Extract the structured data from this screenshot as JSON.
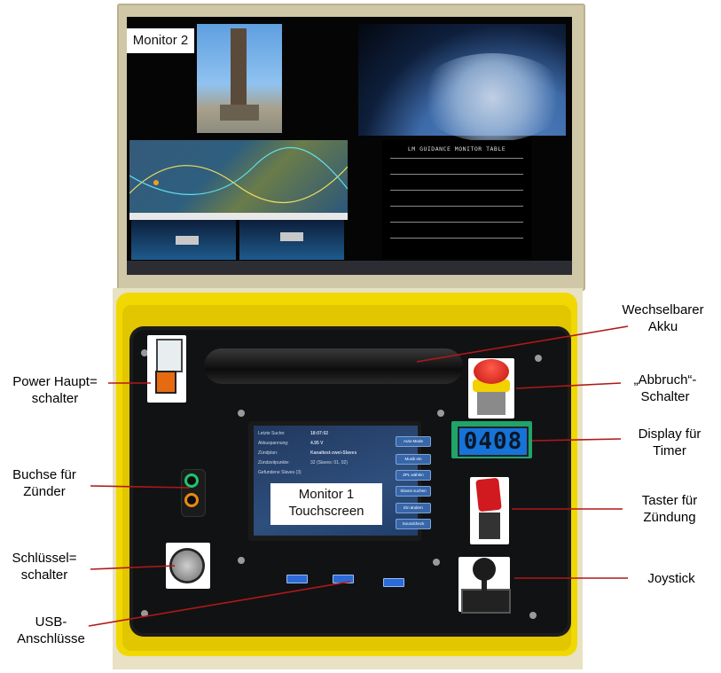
{
  "monitor2": {
    "label": "Monitor 2",
    "guidance_title": "LM GUIDANCE MONITOR TABLE"
  },
  "monitor1": {
    "label_line1": "Monitor 1",
    "label_line2": "Touchscreen",
    "rows": [
      {
        "key": "Letzte Suche:",
        "value": "18:07:02"
      },
      {
        "key": "Akkuspannung:",
        "value": "4.95 V"
      },
      {
        "key": "Zündplan:",
        "value": "Kanaltest-zwei-Slaves"
      },
      {
        "key": "Zündzeitpunkte:",
        "value": "32 (Slaves: 01, 02)"
      },
      {
        "key": "Gefundene Slaves (3)",
        "value": ""
      }
    ],
    "buttons": [
      "Auto-Mode",
      "Musik ein",
      "ZPL wählen",
      "Slaves suchen",
      "Ein ändern",
      "Soundcheck"
    ]
  },
  "timer_display": "0408",
  "callouts": {
    "akku_line1": "Wechselbarer",
    "akku_line2": "Akku",
    "abbruch_line1": "„Abbruch“-",
    "abbruch_line2": "Schalter",
    "display_line1": "Display für",
    "display_line2": "Timer",
    "taster_line1": "Taster für",
    "taster_line2": "Zündung",
    "joystick": "Joystick",
    "power_line1": "Power Haupt=",
    "power_line2": "schalter",
    "buchse_line1": "Buchse für",
    "buchse_line2": "Zünder",
    "schluessel_line1": "Schlüssel=",
    "schluessel_line2": "schalter",
    "usb_line1": "USB-",
    "usb_line2": "Anschlüsse"
  },
  "colors": {
    "case_yellow": "#f0d800",
    "leader_line": "#b01818",
    "monitor_frame": "#cfc7a6"
  }
}
